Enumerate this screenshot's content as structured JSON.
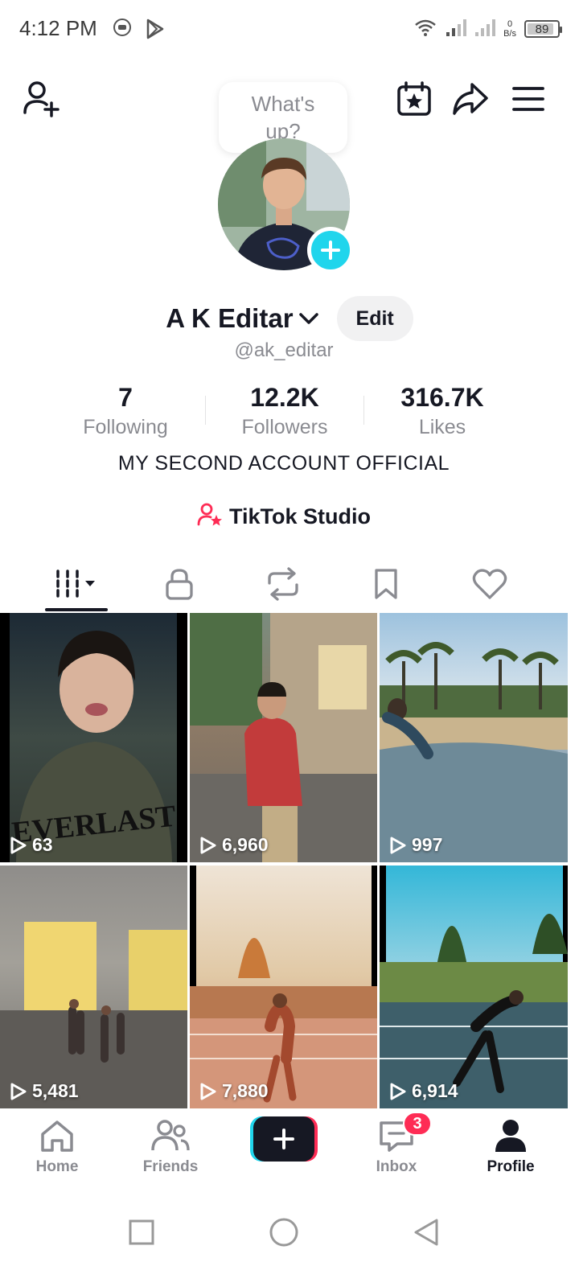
{
  "status_bar": {
    "time": "4:12 PM",
    "net_speed_value": "0",
    "net_speed_unit": "B/s",
    "battery": "89",
    "battery_level": 0.89
  },
  "bubble": {
    "text": "What's up?"
  },
  "profile": {
    "display_name": "A K Editar",
    "edit_label": "Edit",
    "handle": "@ak_editar",
    "bio": "MY SECOND ACCOUNT OFFICIAL",
    "studio_label": "TikTok Studio"
  },
  "stats": [
    {
      "value": "7",
      "label": "Following"
    },
    {
      "value": "12.2K",
      "label": "Followers"
    },
    {
      "value": "316.7K",
      "label": "Likes"
    }
  ],
  "tabs": [
    {
      "icon": "videos-grid-icon"
    },
    {
      "icon": "lock-icon"
    },
    {
      "icon": "repost-icon"
    },
    {
      "icon": "bookmark-icon"
    },
    {
      "icon": "heart-icon"
    }
  ],
  "videos": [
    {
      "views": "63"
    },
    {
      "views": "6,960"
    },
    {
      "views": "997"
    },
    {
      "views": "5,481"
    },
    {
      "views": "7,880"
    },
    {
      "views": "6,914"
    }
  ],
  "bottom_nav": {
    "home": "Home",
    "friends": "Friends",
    "inbox": "Inbox",
    "profile": "Profile",
    "inbox_badge": "3"
  },
  "colors": {
    "accent_cyan": "#20d5ec",
    "accent_pink": "#fe2c55",
    "text_primary": "#161823",
    "text_secondary": "#8a8b91"
  }
}
